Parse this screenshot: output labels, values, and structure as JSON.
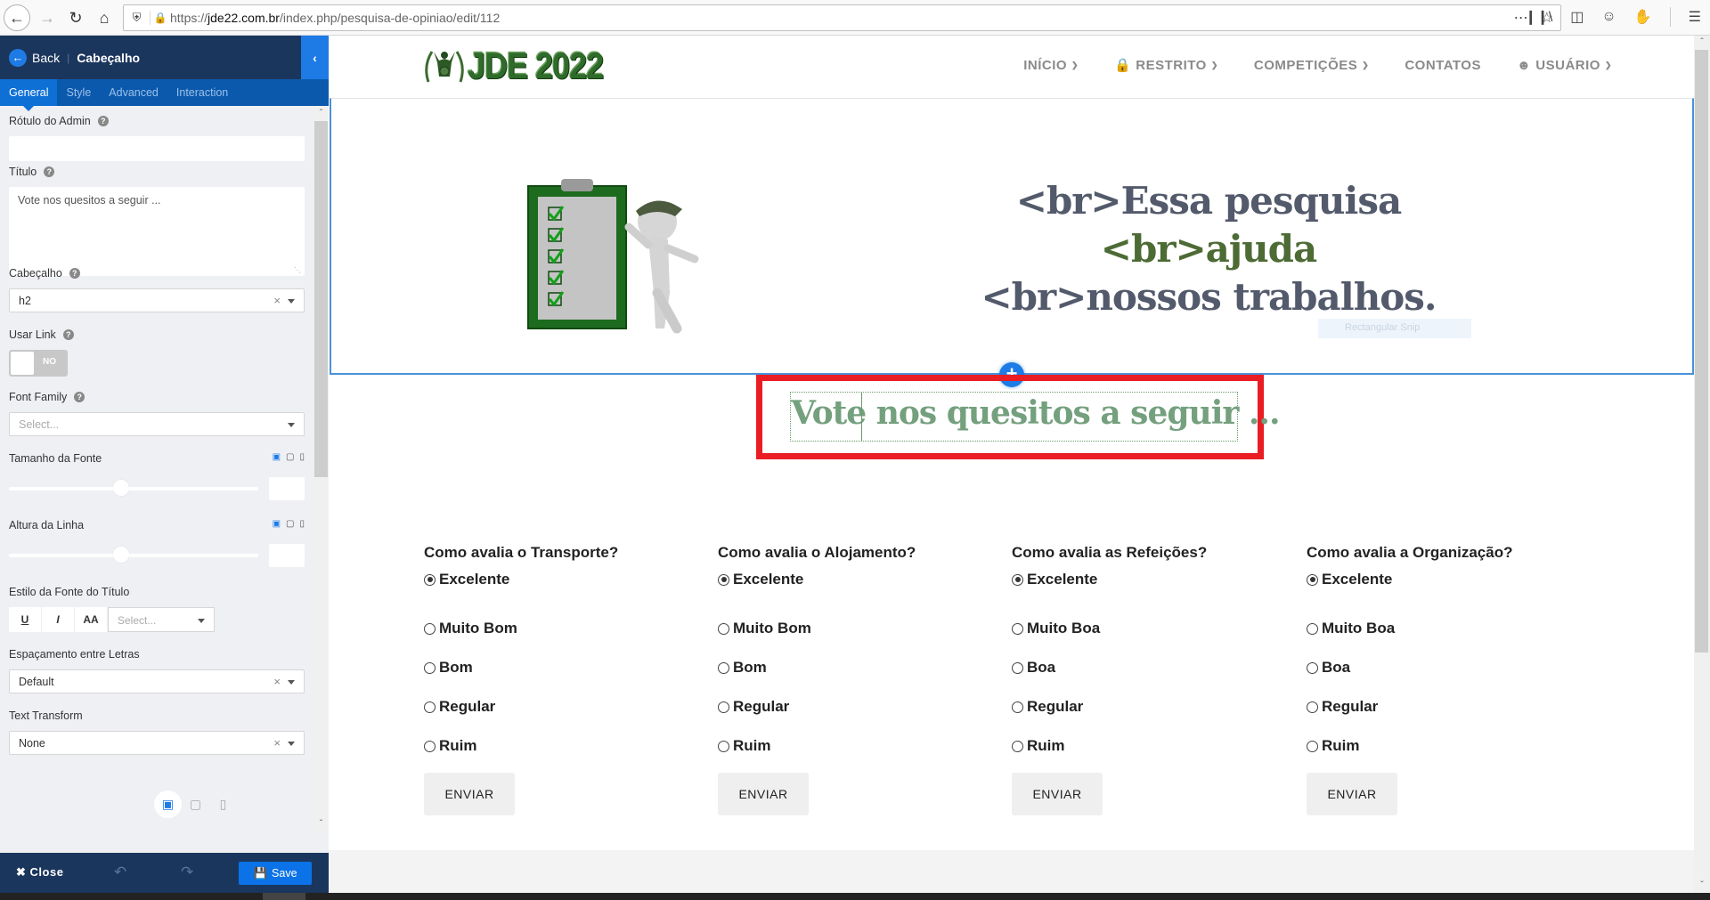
{
  "browser": {
    "url_prefix": "https://",
    "url_domain": "jde22.com.br",
    "url_path": "/index.php/pesquisa-de-opiniao/edit/112",
    "icons": [
      "back-icon",
      "forward-icon",
      "reload-icon",
      "home-icon",
      "shield-icon",
      "lock-icon",
      "more-icon",
      "star-icon",
      "library-icon",
      "sidebar-icon",
      "account-icon",
      "hand-icon",
      "menu-icon"
    ]
  },
  "sidebar": {
    "back_label": "Back",
    "title": "Cabeçalho",
    "tabs": [
      {
        "label": "General",
        "active": true
      },
      {
        "label": "Style",
        "active": false
      },
      {
        "label": "Advanced",
        "active": false
      },
      {
        "label": "Interaction",
        "active": false
      }
    ],
    "fields": {
      "admin_label": {
        "label": "Rótulo do Admin",
        "value": ""
      },
      "title": {
        "label": "Título",
        "value": "Vote nos quesitos a seguir ..."
      },
      "heading": {
        "label": "Cabeçalho",
        "value": "h2"
      },
      "use_link": {
        "label": "Usar Link",
        "state": "NO"
      },
      "font_family": {
        "label": "Font Family",
        "placeholder": "Select..."
      },
      "font_size": {
        "label": "Tamanho da Fonte",
        "slider_fraction": 0.45,
        "value": ""
      },
      "line_height": {
        "label": "Altura da Linha",
        "slider_fraction": 0.45,
        "value": ""
      },
      "font_style": {
        "label": "Estilo da Fonte do Título",
        "buttons": [
          "U",
          "I",
          "AA"
        ],
        "placeholder": "Select..."
      },
      "letter_spacing": {
        "label": "Espaçamento entre Letras",
        "value": "Default"
      },
      "text_transform": {
        "label": "Text Transform",
        "value": "None"
      }
    },
    "footer": {
      "close_label": "Close",
      "save_label": "Save"
    }
  },
  "site": {
    "logo_text": "JDE 2022",
    "nav": [
      {
        "label": "INÍCIO",
        "icon": "",
        "dropdown": true
      },
      {
        "label": "RESTRITO",
        "icon": "lock-icon",
        "dropdown": true
      },
      {
        "label": "COMPETIÇÕES",
        "icon": "",
        "dropdown": true
      },
      {
        "label": "CONTATOS",
        "icon": "",
        "dropdown": false
      },
      {
        "label": "USUÁRIO",
        "icon": "user-circle-icon",
        "dropdown": true
      }
    ],
    "hero": {
      "line1_a": "<br>Essa pesquisa ",
      "line1_b": "<br>ajuda",
      "line2": "<br>nossos trabalhos.",
      "ghost_text": "Rectangular Snip"
    },
    "heading": "Vote nos quesitos a seguir ...",
    "questions": [
      {
        "title": "Como avalia o Transporte?",
        "options": [
          "Excelente",
          "Muito Bom",
          "Bom",
          "Regular",
          "Ruim"
        ],
        "selected": 0,
        "button": "ENVIAR"
      },
      {
        "title": "Como avalia o Alojamento?",
        "options": [
          "Excelente",
          "Muito Bom",
          "Bom",
          "Regular",
          "Ruim"
        ],
        "selected": 0,
        "button": "ENVIAR"
      },
      {
        "title": "Como avalia as Refeições?",
        "options": [
          "Excelente",
          "Muito Boa",
          "Boa",
          "Regular",
          "Ruim"
        ],
        "selected": 0,
        "button": "ENVIAR"
      },
      {
        "title": "Como avalia a Organização?",
        "options": [
          "Excelente",
          "Muito Boa",
          "Boa",
          "Regular",
          "Ruim"
        ],
        "selected": 0,
        "button": "ENVIAR"
      }
    ]
  },
  "colors": {
    "sidebar_header": "#1b365d",
    "sidebar_tabs": "#0a59ad",
    "accent_blue": "#1e7be6",
    "highlight_red": "#ea1c24",
    "heading_green": "#74a07e",
    "hero_text": "#535a6b"
  }
}
